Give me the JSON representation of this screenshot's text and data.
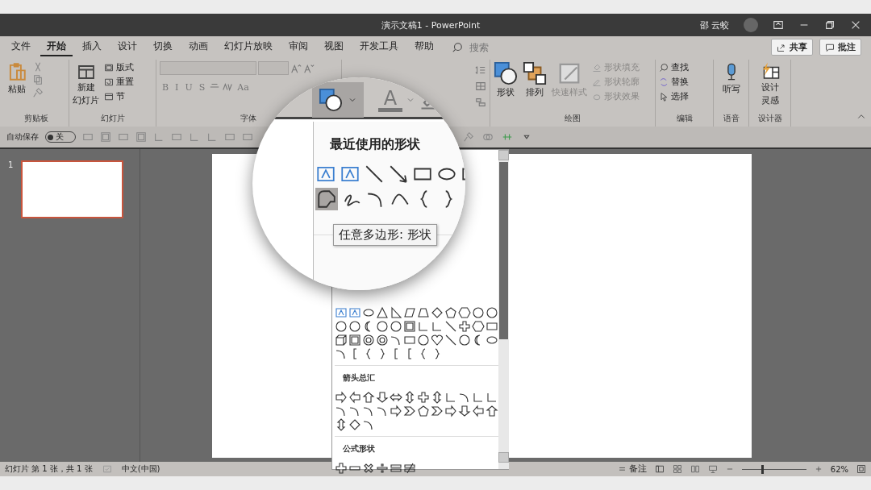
{
  "window": {
    "title": "演示文稿1 - PowerPoint",
    "user": "邵 云蛟"
  },
  "menu_tabs": [
    {
      "label": "文件",
      "selected": false
    },
    {
      "label": "开始",
      "selected": true
    },
    {
      "label": "插入",
      "selected": false
    },
    {
      "label": "设计",
      "selected": false
    },
    {
      "label": "切换",
      "selected": false
    },
    {
      "label": "动画",
      "selected": false
    },
    {
      "label": "幻灯片放映",
      "selected": false
    },
    {
      "label": "审阅",
      "selected": false
    },
    {
      "label": "视图",
      "selected": false
    },
    {
      "label": "开发工具",
      "selected": false
    },
    {
      "label": "帮助",
      "selected": false
    }
  ],
  "search": {
    "placeholder": "搜索"
  },
  "share_button": "共享",
  "comment_button": "批注",
  "ribbon": {
    "clipboard": {
      "paste": "粘贴",
      "label": "剪贴板"
    },
    "slides": {
      "new_line1": "新建",
      "new_line2": "幻灯片",
      "layout": "版式",
      "reset": "重置",
      "section": "节",
      "label": "幻灯片"
    },
    "font": {
      "format_buttons": [
        "B",
        "I",
        "U",
        "S"
      ],
      "change_case": "Aa",
      "label": "字体"
    },
    "drawing": {
      "shapes": "形状",
      "arrange": "排列",
      "quick_styles": "快速样式",
      "fill": "形状填充",
      "outline": "形状轮廓",
      "effects": "形状效果",
      "label": "绘图"
    },
    "editing": {
      "find": "查找",
      "replace": "替换",
      "select": "选择",
      "label": "编辑"
    },
    "voice": {
      "dictate": "听写",
      "label": "语音"
    },
    "designer": {
      "line1": "设计",
      "line2": "灵感",
      "label": "设计器"
    }
  },
  "quick_access": {
    "autosave": "自动保存",
    "toggle": "关",
    "on": false
  },
  "slides_pane": [
    {
      "number": "1",
      "selected": true
    }
  ],
  "magnifier": {
    "font_color": "A"
  },
  "shapes_menu": {
    "sections": [
      {
        "title": "最近使用的形状"
      },
      {
        "title": "箭头总汇"
      },
      {
        "title": "公式形状"
      }
    ],
    "tooltip": "任意多边形: 形状"
  },
  "status_bar": {
    "slide_info": "幻灯片 第 1 张，共 1 张",
    "language": "中文(中国)",
    "notes": "备注",
    "zoom": "62%",
    "zoom_slider": {
      "level": 0.3
    }
  }
}
